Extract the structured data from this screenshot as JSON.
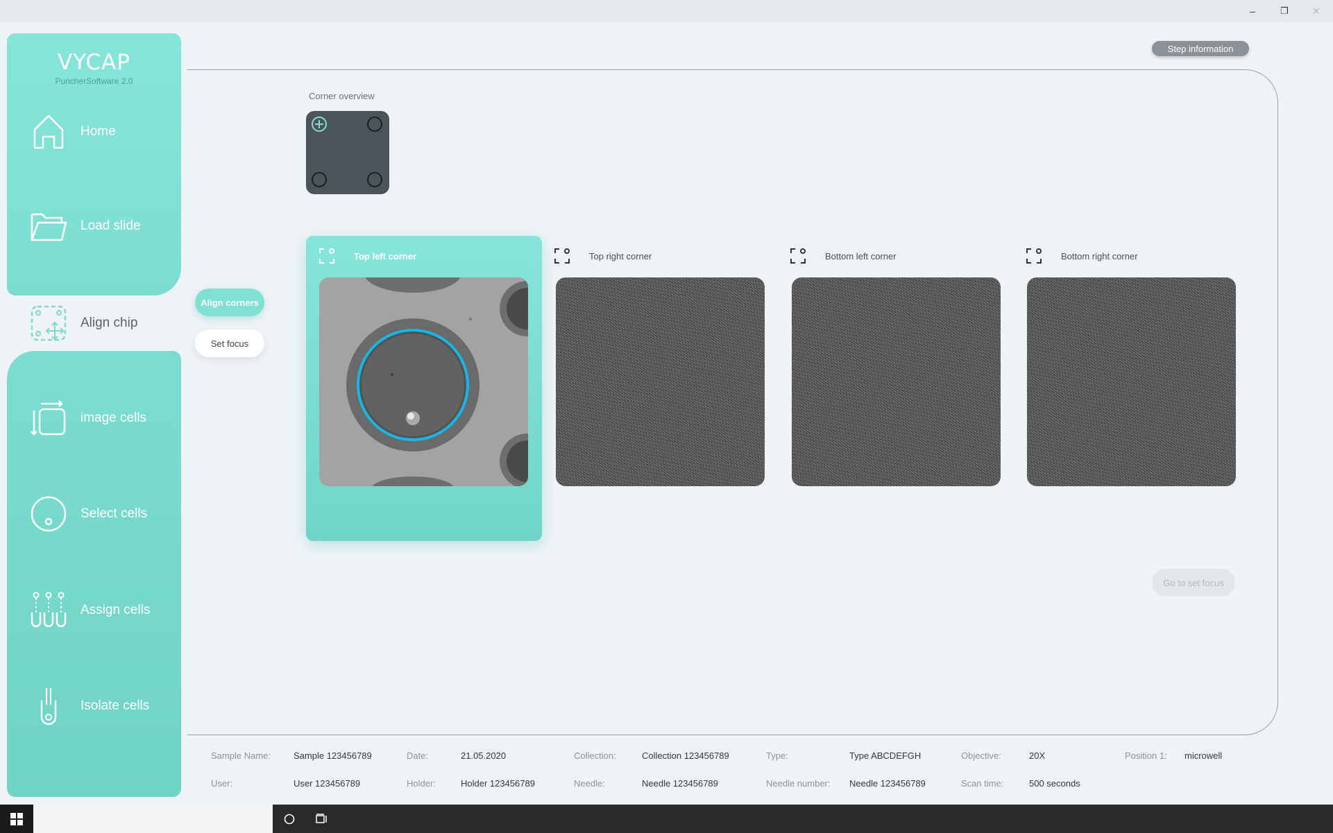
{
  "window": {
    "controls": {
      "minimize": "–",
      "restore": "❐",
      "close": "✕"
    }
  },
  "brand": {
    "title": "VYCAP",
    "subtitle": "PuncherSoftware 2.0"
  },
  "sidebar": {
    "items": [
      {
        "label": "Home",
        "icon": "home-icon"
      },
      {
        "label": "Load slide",
        "icon": "folder-icon"
      },
      {
        "label": "Align chip",
        "icon": "align-chip-icon",
        "active": true
      },
      {
        "label": "image cells",
        "icon": "image-cells-icon"
      },
      {
        "label": "Select cells",
        "icon": "select-cells-icon"
      },
      {
        "label": "Assign cells",
        "icon": "assign-cells-icon"
      },
      {
        "label": "Isolate cells",
        "icon": "isolate-cells-icon"
      }
    ]
  },
  "subnav": {
    "align_corners": "Align corners",
    "set_focus": "Set focus"
  },
  "header": {
    "step_information": "Step information"
  },
  "overview": {
    "title": "Corner overview"
  },
  "corners": [
    {
      "label": "Top left corner",
      "active": true
    },
    {
      "label": "Top right corner"
    },
    {
      "label": "Bottom left corner"
    },
    {
      "label": "Bottom right corner"
    }
  ],
  "actions": {
    "go_to_set_focus": "Go to set focus"
  },
  "info": {
    "row1": [
      {
        "key": "Sample Name:",
        "value": "Sample 123456789"
      },
      {
        "key": "Date:",
        "value": "21.05.2020"
      },
      {
        "key": "Collection:",
        "value": "Collection 123456789"
      },
      {
        "key": "Type:",
        "value": "Type ABCDEFGH"
      },
      {
        "key": "Objective:",
        "value": "20X"
      },
      {
        "key": "Position 1:",
        "value": "microwell"
      }
    ],
    "row2": [
      {
        "key": "User:",
        "value": "User 123456789"
      },
      {
        "key": "Holder:",
        "value": "Holder 123456789"
      },
      {
        "key": "Needle:",
        "value": "Needle 123456789"
      },
      {
        "key": "Needle number:",
        "value": "Needle 123456789"
      },
      {
        "key": "Scan time:",
        "value": "500 seconds"
      }
    ]
  },
  "colors": {
    "accent": "#80e0d4",
    "ring": "#1cb8e6",
    "tile_dark": "#4b5459"
  }
}
